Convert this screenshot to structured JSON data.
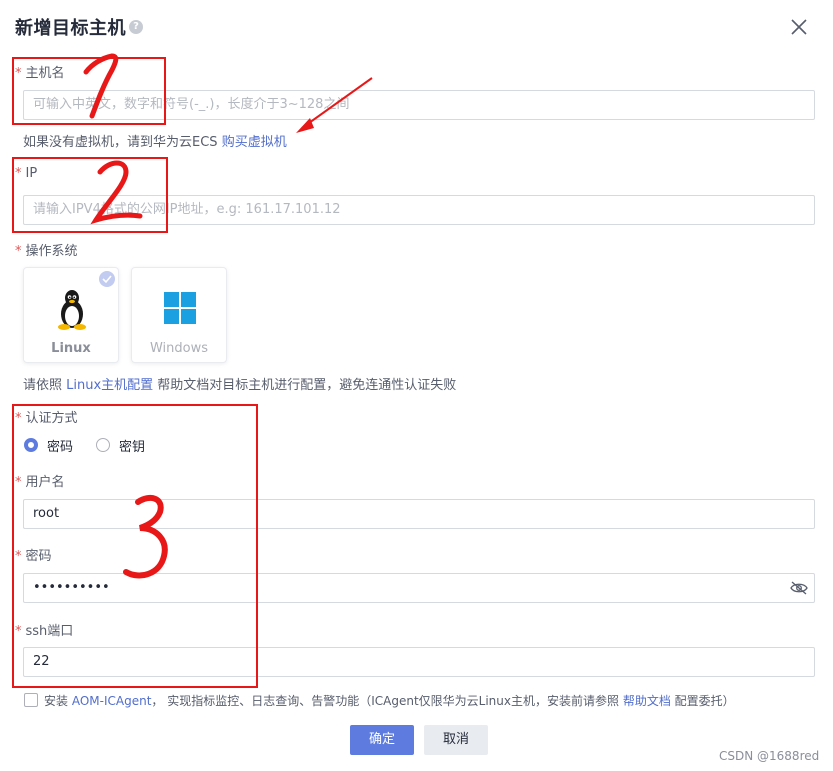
{
  "dialog": {
    "title": "新增目标主机",
    "help_icon": "question-circle-icon",
    "close_icon": "close-icon"
  },
  "hostname": {
    "required_mark": "*",
    "label": "主机名",
    "placeholder": "可输入中英文，数字和符号(-_.)，长度介于3~128之间",
    "hint_prefix": "如果没有虚拟机，请到华为云ECS ",
    "hint_link": "购买虚拟机"
  },
  "ip": {
    "required_mark": "*",
    "label": "IP",
    "placeholder": "请输入IPV4格式的公网IP地址，e.g: 161.17.101.12"
  },
  "os": {
    "required_mark": "*",
    "label": "操作系统",
    "options": [
      {
        "name": "Linux",
        "icon": "linux-penguin-icon",
        "selected": true
      },
      {
        "name": "Windows",
        "icon": "windows-logo-icon",
        "selected": false
      }
    ],
    "hint_prefix": "请依照 ",
    "hint_link": "Linux主机配置",
    "hint_suffix": " 帮助文档对目标主机进行配置，避免连通性认证失败"
  },
  "auth": {
    "required_mark": "*",
    "label": "认证方式",
    "options": [
      {
        "label": "密码",
        "selected": true
      },
      {
        "label": "密钥",
        "selected": false
      }
    ]
  },
  "username": {
    "required_mark": "*",
    "label": "用户名",
    "value": "root"
  },
  "password": {
    "required_mark": "*",
    "label": "密码",
    "value": "••••••••••",
    "toggle_icon": "eye-off-icon"
  },
  "ssh_port": {
    "required_mark": "*",
    "label": "ssh端口",
    "value": "22"
  },
  "install_agent": {
    "checked": false,
    "text_prefix": "安装 ",
    "link": "AOM-ICAgent",
    "text_middle": "， 实现指标监控、日志查询、告警功能（ICAgent仅限华为云Linux主机，安装前请参照 ",
    "link2": "帮助文档",
    "text_suffix": " 配置委托）"
  },
  "buttons": {
    "confirm": "确定",
    "cancel": "取消"
  },
  "watermark": "CSDN @1688red",
  "annotations": {
    "colors": {
      "box": "#e81818",
      "accent": "#5e7ce0",
      "required": "#e05656"
    }
  }
}
